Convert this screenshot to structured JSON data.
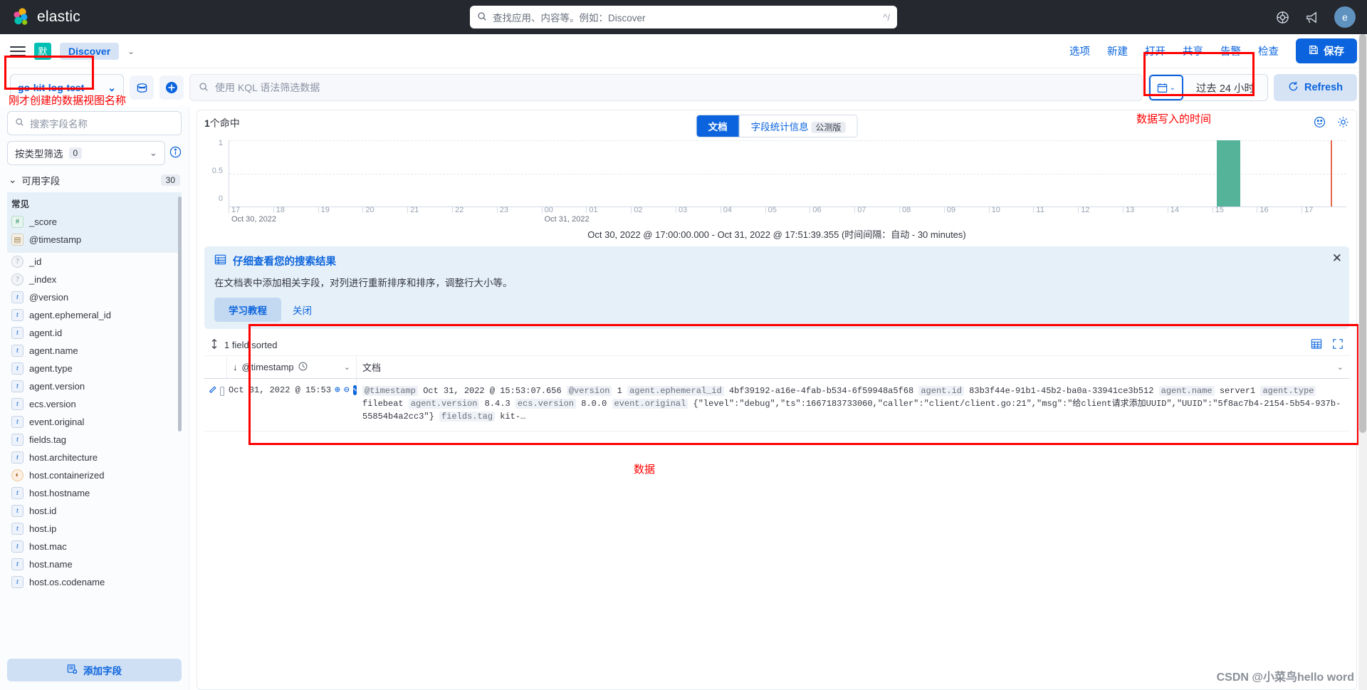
{
  "topbar": {
    "brand": "elastic",
    "search_placeholder": "查找应用、内容等。例如：Discover",
    "search_kbd": "^/",
    "help_icon": "help-icon",
    "news_icon": "megaphone-icon",
    "avatar_letter": "e"
  },
  "appbar": {
    "space_badge": "默",
    "breadcrumb": "Discover",
    "links": [
      "选项",
      "新建",
      "打开",
      "共享",
      "告警",
      "检查"
    ],
    "save_label": "保存"
  },
  "querybar": {
    "data_view": "go-kit-log-test",
    "kql_placeholder": "使用 KQL 语法筛选数据",
    "time_range": "过去 24 小时",
    "refresh_label": "Refresh"
  },
  "sidebar": {
    "search_placeholder": "搜索字段名称",
    "type_filter_label": "按类型筛选",
    "type_filter_count": "0",
    "available_label": "可用字段",
    "available_count": "30",
    "popular_label": "常见",
    "popular_fields": [
      {
        "name": "_score",
        "type": "number",
        "glyph": "#"
      },
      {
        "name": "@timestamp",
        "type": "date",
        "glyph": "▤"
      }
    ],
    "fields": [
      {
        "name": "_id",
        "type": "unknown",
        "glyph": "?"
      },
      {
        "name": "_index",
        "type": "unknown",
        "glyph": "?"
      },
      {
        "name": "@version",
        "type": "string",
        "glyph": "t"
      },
      {
        "name": "agent.ephemeral_id",
        "type": "string",
        "glyph": "t"
      },
      {
        "name": "agent.id",
        "type": "string",
        "glyph": "t"
      },
      {
        "name": "agent.name",
        "type": "string",
        "glyph": "t"
      },
      {
        "name": "agent.type",
        "type": "string",
        "glyph": "t"
      },
      {
        "name": "agent.version",
        "type": "string",
        "glyph": "t"
      },
      {
        "name": "ecs.version",
        "type": "string",
        "glyph": "t"
      },
      {
        "name": "event.original",
        "type": "string",
        "glyph": "t"
      },
      {
        "name": "fields.tag",
        "type": "string",
        "glyph": "t"
      },
      {
        "name": "host.architecture",
        "type": "string",
        "glyph": "t"
      },
      {
        "name": "host.containerized",
        "type": "boolean",
        "glyph": "◐"
      },
      {
        "name": "host.hostname",
        "type": "string",
        "glyph": "t"
      },
      {
        "name": "host.id",
        "type": "string",
        "glyph": "t"
      },
      {
        "name": "host.ip",
        "type": "string",
        "glyph": "t"
      },
      {
        "name": "host.mac",
        "type": "string",
        "glyph": "t"
      },
      {
        "name": "host.name",
        "type": "string",
        "glyph": "t"
      },
      {
        "name": "host.os.codename",
        "type": "string",
        "glyph": "t"
      }
    ],
    "add_field_label": "添加字段"
  },
  "content": {
    "hits_count": "1",
    "hits_suffix": "个命中",
    "tabs": [
      {
        "label": "文档",
        "active": true,
        "beta": ""
      },
      {
        "label": "字段统计信息",
        "active": false,
        "beta": "公测版"
      }
    ],
    "range_caption": "Oct 30, 2022 @ 17:00:00.000 - Oct 31, 2022 @ 17:51:39.355  (时间间隔：自动 - 30 minutes)"
  },
  "chart_data": {
    "type": "bar",
    "title": "",
    "xlabel": "",
    "ylabel": "",
    "ylim": [
      0,
      1
    ],
    "y_ticks": [
      "0",
      "0.5",
      "1"
    ],
    "grid": true,
    "x_ticks": [
      {
        "label": "17",
        "sub": "Oct 30, 2022"
      },
      {
        "label": "18",
        "sub": ""
      },
      {
        "label": "19",
        "sub": ""
      },
      {
        "label": "20",
        "sub": ""
      },
      {
        "label": "21",
        "sub": ""
      },
      {
        "label": "22",
        "sub": ""
      },
      {
        "label": "23",
        "sub": ""
      },
      {
        "label": "00",
        "sub": "Oct 31, 2022"
      },
      {
        "label": "01",
        "sub": ""
      },
      {
        "label": "02",
        "sub": ""
      },
      {
        "label": "03",
        "sub": ""
      },
      {
        "label": "04",
        "sub": ""
      },
      {
        "label": "05",
        "sub": ""
      },
      {
        "label": "06",
        "sub": ""
      },
      {
        "label": "07",
        "sub": ""
      },
      {
        "label": "08",
        "sub": ""
      },
      {
        "label": "09",
        "sub": ""
      },
      {
        "label": "10",
        "sub": ""
      },
      {
        "label": "11",
        "sub": ""
      },
      {
        "label": "12",
        "sub": ""
      },
      {
        "label": "13",
        "sub": ""
      },
      {
        "label": "14",
        "sub": ""
      },
      {
        "label": "15",
        "sub": ""
      },
      {
        "label": "16",
        "sub": ""
      },
      {
        "label": "17",
        "sub": ""
      }
    ],
    "bars": [
      {
        "x": "15:30",
        "value": 1
      }
    ],
    "bar_color": "#54b399",
    "end_marker_color": "#e7664c"
  },
  "callout": {
    "title": "仔细查看您的搜索结果",
    "body": "在文档表中添加相关字段，对列进行重新排序和排序，调整行大小等。",
    "primary_label": "学习教程",
    "secondary_label": "关闭",
    "close_icon": "close-icon"
  },
  "datagrid": {
    "sorted_label": "1 field sorted",
    "columns": [
      "@timestamp",
      "文档"
    ],
    "rows": [
      {
        "timestamp": "Oct 31, 2022 @ 15:53",
        "fields": [
          {
            "key": "@timestamp",
            "value": "Oct 31, 2022 @ 15:53:07.656"
          },
          {
            "key": "@version",
            "value": "1"
          },
          {
            "key": "agent.ephemeral_id",
            "value": "4bf39192-a16e-4fab-b534-6f59948a5f68"
          },
          {
            "key": "agent.id",
            "value": "83b3f44e-91b1-45b2-ba0a-33941ce3b512"
          },
          {
            "key": "agent.name",
            "value": "server1"
          },
          {
            "key": "agent.type",
            "value": "filebeat"
          },
          {
            "key": "agent.version",
            "value": "8.4.3"
          },
          {
            "key": "ecs.version",
            "value": "8.0.0"
          },
          {
            "key": "event.original",
            "value": "{\"level\":\"debug\",\"ts\":1667183733060,\"caller\":\"client/client.go:21\",\"msg\":\"给client请求添加UUID\",\"UUID\":\"5f8ac7b4-2154-5b54-937b-55854b4a2cc3\"}"
          },
          {
            "key": "fields.tag",
            "value": "kit-…"
          }
        ]
      }
    ]
  },
  "annotations": [
    {
      "id": "data-view-note",
      "text": "刚才创建的数据视图名称"
    },
    {
      "id": "time-note",
      "text": "数据写入的时间"
    },
    {
      "id": "data-note",
      "text": "数据"
    }
  ],
  "watermark": "CSDN @小菜鸟hello word"
}
